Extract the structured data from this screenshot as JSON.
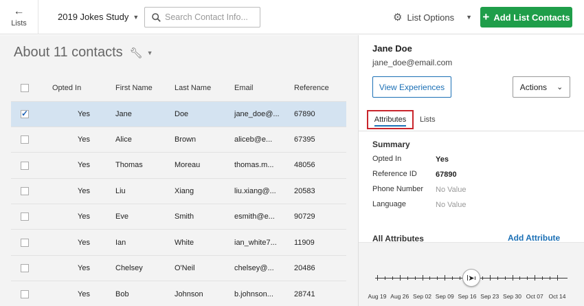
{
  "header": {
    "back_label": "Lists",
    "study_name": "2019 Jokes Study",
    "search_placeholder": "Search Contact Info...",
    "list_options_label": "List Options",
    "add_button_label": "Add List Contacts"
  },
  "contacts": {
    "title": "About 11 contacts",
    "columns": [
      "Opted In",
      "First Name",
      "Last Name",
      "Email",
      "Reference"
    ],
    "rows": [
      {
        "opted_in": "Yes",
        "first": "Jane",
        "last": "Doe",
        "email": "jane_doe@...",
        "reference": "67890",
        "selected": true
      },
      {
        "opted_in": "Yes",
        "first": "Alice",
        "last": "Brown",
        "email": "aliceb@e...",
        "reference": "67395",
        "selected": false
      },
      {
        "opted_in": "Yes",
        "first": "Thomas",
        "last": "Moreau",
        "email": "thomas.m...",
        "reference": "48056",
        "selected": false
      },
      {
        "opted_in": "Yes",
        "first": "Liu",
        "last": "Xiang",
        "email": "liu.xiang@...",
        "reference": "20583",
        "selected": false
      },
      {
        "opted_in": "Yes",
        "first": "Eve",
        "last": "Smith",
        "email": "esmith@e...",
        "reference": "90729",
        "selected": false
      },
      {
        "opted_in": "Yes",
        "first": "Ian",
        "last": "White",
        "email": "ian_white7...",
        "reference": "11909",
        "selected": false
      },
      {
        "opted_in": "Yes",
        "first": "Chelsey",
        "last": "O'Neil",
        "email": "chelsey@...",
        "reference": "20486",
        "selected": false
      },
      {
        "opted_in": "Yes",
        "first": "Bob",
        "last": "Johnson",
        "email": "b.johnson...",
        "reference": "28741",
        "selected": false
      }
    ]
  },
  "detail": {
    "name": "Jane Doe",
    "email": "jane_doe@email.com",
    "view_button_label": "View Experiences",
    "actions_label": "Actions",
    "tabs": {
      "attributes": "Attributes",
      "lists": "Lists"
    },
    "summary_heading": "Summary",
    "summary": [
      {
        "label": "Opted In",
        "value": "Yes",
        "empty": false
      },
      {
        "label": "Reference ID",
        "value": "67890",
        "empty": false
      },
      {
        "label": "Phone Number",
        "value": "No Value",
        "empty": true
      },
      {
        "label": "Language",
        "value": "No Value",
        "empty": true
      }
    ],
    "all_attributes_heading": "All Attributes",
    "add_attribute_label": "Add Attribute",
    "timeline_dates": [
      "Aug 19",
      "Aug 26",
      "Sep 02",
      "Sep 09",
      "Sep 16",
      "Sep 23",
      "Sep 30",
      "Oct 07",
      "Oct 14"
    ],
    "timeline_marker_date": "Sep 16"
  },
  "colors": {
    "accent_blue": "#1a6fb5",
    "add_green": "#1f9e4a",
    "highlight_red": "#c9242b",
    "selected_row": "#d4e3f1"
  }
}
